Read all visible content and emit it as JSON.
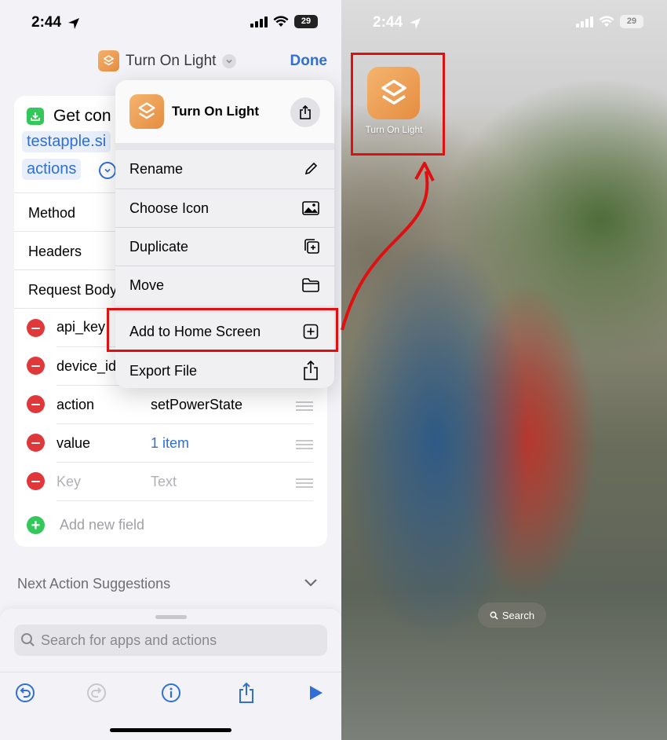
{
  "left": {
    "status": {
      "time": "2:44",
      "battery": "29"
    },
    "nav": {
      "title": "Turn On Light",
      "done_label": "Done"
    },
    "action_card": {
      "title": "Get con",
      "url_token": "testapple.si",
      "actions_token": "actions",
      "rows": [
        {
          "label": "Method"
        },
        {
          "label": "Headers"
        },
        {
          "label": "Request Body"
        }
      ],
      "fields": [
        {
          "key": "api_key",
          "value": ""
        },
        {
          "key": "device_id",
          "value": ""
        },
        {
          "key": "action",
          "value": "setPowerState"
        },
        {
          "key": "value",
          "value": "1 item"
        }
      ],
      "placeholder_key": "Key",
      "placeholder_value": "Text",
      "add_field_label": "Add new field"
    },
    "suggestions_label": "Next Action Suggestions",
    "search": {
      "placeholder": "Search for apps and actions"
    },
    "menu": {
      "shortcut_name": "Turn On Light",
      "items": [
        {
          "label": "Rename",
          "icon": "pencil-icon"
        },
        {
          "label": "Choose Icon",
          "icon": "photo-icon"
        },
        {
          "label": "Duplicate",
          "icon": "duplicate-icon"
        },
        {
          "label": "Move",
          "icon": "folder-icon"
        },
        {
          "label": "Add to Home Screen",
          "icon": "plus-square-icon"
        },
        {
          "label": "Export File",
          "icon": "share-icon"
        }
      ]
    }
  },
  "right": {
    "status": {
      "time": "2:44",
      "battery": "29"
    },
    "home_app_label": "Turn On Light",
    "search_pill_label": "Search"
  },
  "colors": {
    "accent": "#2f6fd6",
    "annotation": "#e01010",
    "shortcut_icon": "#e8974a"
  }
}
